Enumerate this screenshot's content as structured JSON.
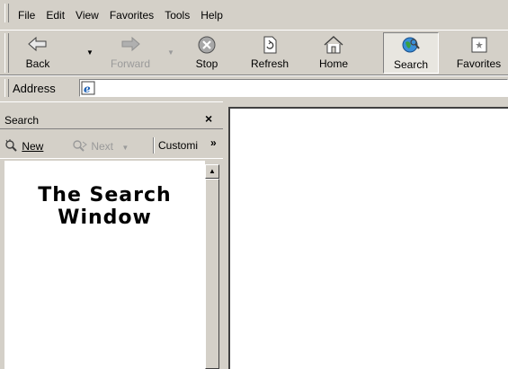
{
  "menu": {
    "items": [
      {
        "label": "File"
      },
      {
        "label": "Edit"
      },
      {
        "label": "View"
      },
      {
        "label": "Favorites"
      },
      {
        "label": "Tools"
      },
      {
        "label": "Help"
      }
    ]
  },
  "toolbar": {
    "back_label": "Back",
    "forward_label": "Forward",
    "stop_label": "Stop",
    "refresh_label": "Refresh",
    "home_label": "Home",
    "search_label": "Search",
    "favorites_label": "Favorites"
  },
  "address": {
    "label": "Address",
    "value": ""
  },
  "explorer_pane": {
    "title": "Search",
    "close_glyph": "×",
    "new_label": "New",
    "next_label": "Next",
    "customize_label": "Customi",
    "more_glyph": "»",
    "heading_line1": "The Search",
    "heading_line2": "Window"
  },
  "colors": {
    "chrome": "#d4d0c8",
    "highlight": "#ffffff",
    "shadow": "#808080",
    "disabled_text": "#9a9a9a"
  },
  "icons": {
    "back": "back-arrow-icon",
    "forward": "forward-arrow-icon",
    "stop": "stop-icon",
    "refresh": "refresh-icon",
    "home": "home-icon",
    "search": "search-globe-icon",
    "favorites": "favorites-icon",
    "address": "ie-page-icon"
  }
}
